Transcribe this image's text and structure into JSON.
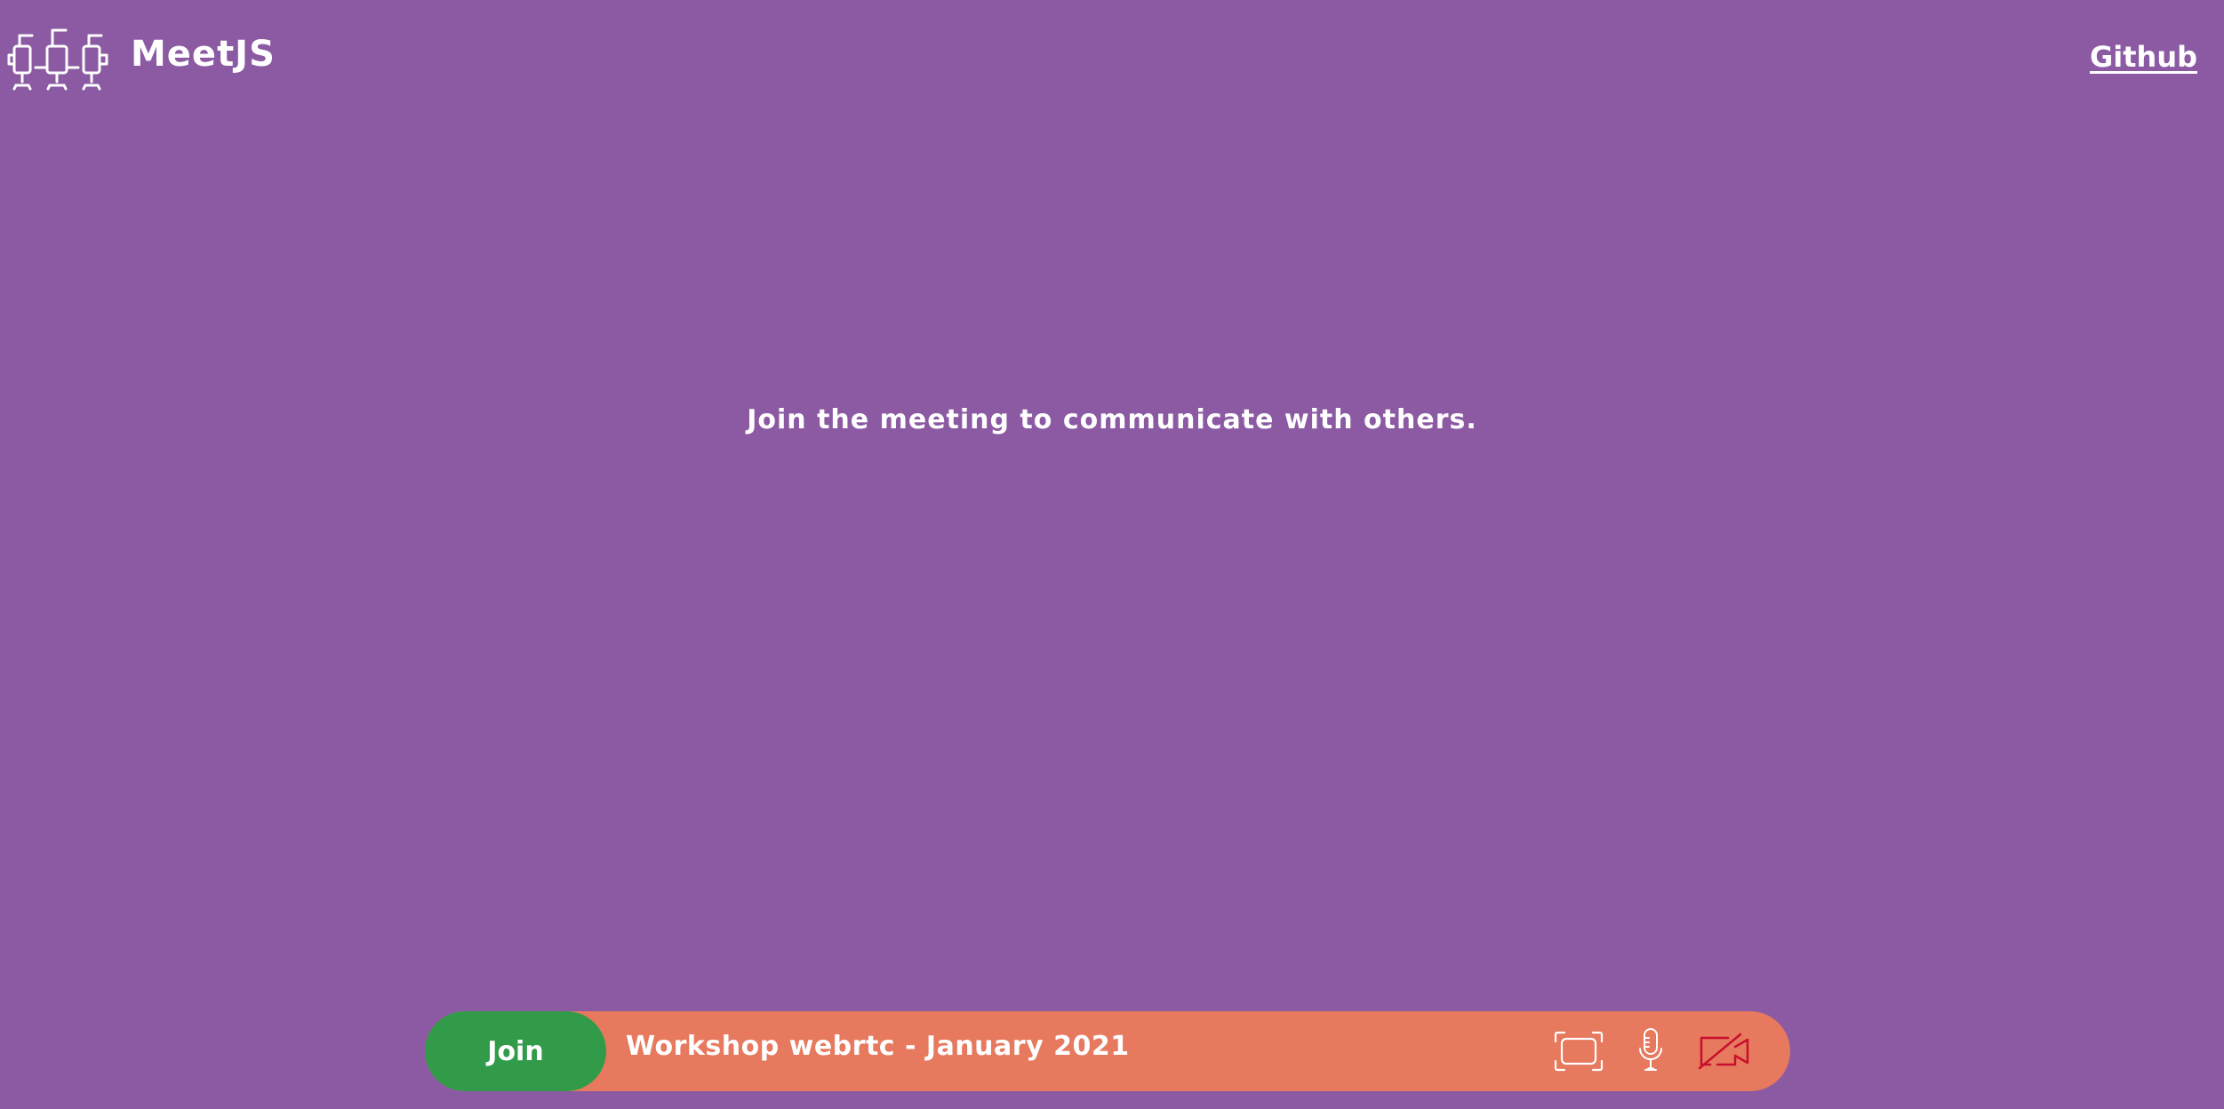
{
  "header": {
    "logo_icon": "people-group-icon",
    "brand": "MeetJS",
    "github_label": "Github"
  },
  "main": {
    "message": "Join the meeting to communicate with others."
  },
  "bottom_bar": {
    "join_label": "Join",
    "meeting_title": "Workshop webrtc - January 2021",
    "controls": [
      {
        "icon": "fullscreen-icon",
        "state": "default"
      },
      {
        "icon": "microphone-icon",
        "state": "on"
      },
      {
        "icon": "camera-off-icon",
        "state": "off"
      }
    ]
  },
  "colors": {
    "background": "#8b5aa3",
    "bar": "#e6795e",
    "join_button": "#329b4a",
    "camera_off": "#c8102e",
    "text": "#ffffff"
  }
}
